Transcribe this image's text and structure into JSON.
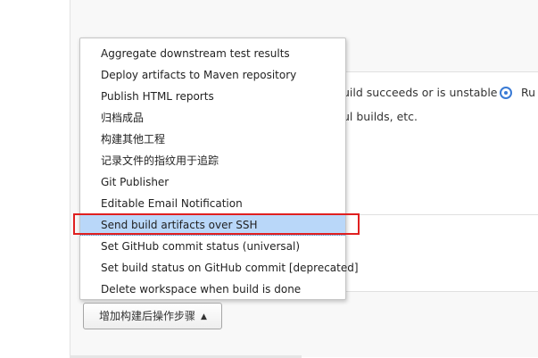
{
  "background": {
    "line1": "uild succeeds or is unstable",
    "radio_label": "Ru",
    "line2": "ul builds, etc."
  },
  "menu": {
    "items": [
      {
        "label": "Aggregate downstream test results"
      },
      {
        "label": "Deploy artifacts to Maven repository"
      },
      {
        "label": "Publish HTML reports"
      },
      {
        "label": "归档成品"
      },
      {
        "label": "构建其他工程"
      },
      {
        "label": "记录文件的指纹用于追踪"
      },
      {
        "label": "Git Publisher"
      },
      {
        "label": "Editable Email Notification"
      },
      {
        "label": "Send build artifacts over SSH",
        "selected": true
      },
      {
        "label": "Set GitHub commit status (universal)"
      },
      {
        "label": "Set build status on GitHub commit [deprecated]"
      },
      {
        "label": "Delete workspace when build is done"
      }
    ]
  },
  "add_post_build_button": {
    "label": "增加构建后操作步骤",
    "icon": "caret-up-icon"
  },
  "colors": {
    "selection": "#b9d7f9",
    "highlight_outline": "#e02020",
    "radio_accent": "#3a7bd5"
  }
}
